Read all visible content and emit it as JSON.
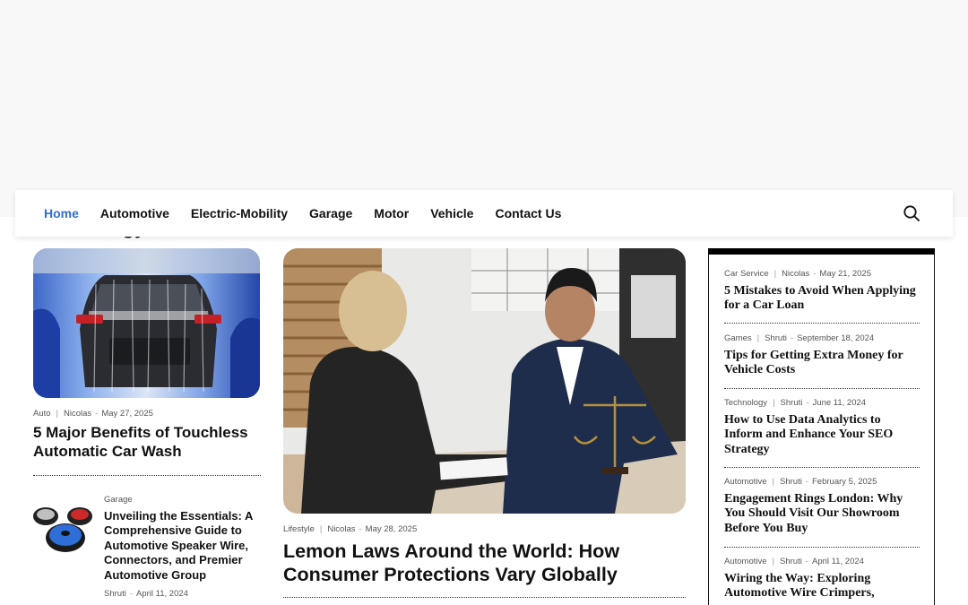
{
  "nav": {
    "items": [
      {
        "label": "Home",
        "active": true
      },
      {
        "label": "Automotive",
        "active": false
      },
      {
        "label": "Electric-Mobility",
        "active": false
      },
      {
        "label": "Garage",
        "active": false
      },
      {
        "label": "Motor",
        "active": false
      },
      {
        "label": "Vehicle",
        "active": false
      },
      {
        "label": "Contact Us",
        "active": false
      }
    ],
    "search_icon": "search-icon",
    "active_color": "#2d6fd1"
  },
  "left_feature": {
    "category": "Auto",
    "author": "Nicolas",
    "date": "May 27, 2025",
    "title": "5 Major Benefits of Touchless Automatic Car Wash"
  },
  "left_small": {
    "category": "Garage",
    "title": "Unveiling the Essentials: A Comprehensive Guide to Automotive Speaker Wire, Connectors, and Premier Automotive Group",
    "author": "Shruti",
    "date": "April 11, 2024"
  },
  "center_feature": {
    "category": "Lifestyle",
    "author": "Nicolas",
    "date": "May 28, 2025",
    "title": "Lemon Laws Around the World: How Consumer Protections Vary Globally"
  },
  "sidebar": {
    "items": [
      {
        "category": "Car Service",
        "author": "Nicolas",
        "date": "May 21, 2025",
        "title": "5 Mistakes to Avoid When Applying for a Car Loan"
      },
      {
        "category": "Games",
        "author": "Shruti",
        "date": "September 18, 2024",
        "title": "Tips for Getting Extra Money for Vehicle Costs"
      },
      {
        "category": "Technology",
        "author": "Shruti",
        "date": "June 11, 2024",
        "title": "How to Use Data Analytics to Inform and Enhance Your SEO Strategy"
      },
      {
        "category": "Automotive",
        "author": "Shruti",
        "date": "February 5, 2025",
        "title": "Engagement Rings London: Why You Should Visit Our Showroom Before You Buy"
      },
      {
        "category": "Automotive",
        "author": "Shruti",
        "date": "April 11, 2024",
        "title": "Wiring the Way: Exploring Automotive Wire Crimpers,"
      }
    ]
  }
}
